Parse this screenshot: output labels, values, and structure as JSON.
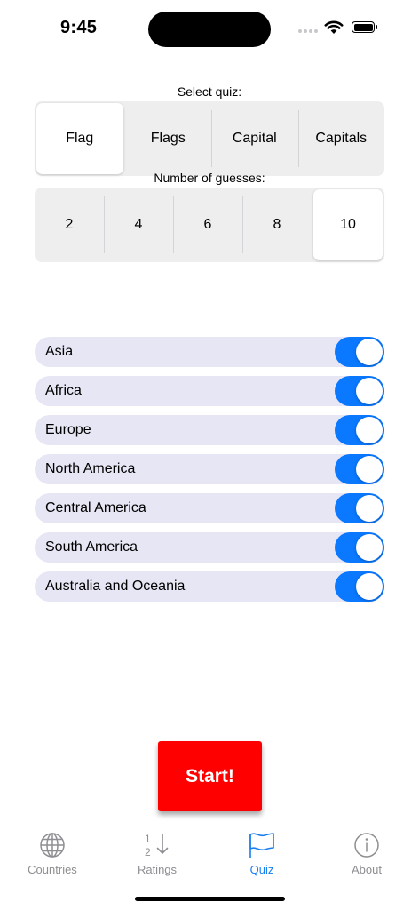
{
  "status_bar": {
    "time": "9:45"
  },
  "quiz_selector": {
    "label": "Select quiz:",
    "options": [
      "Flag",
      "Flags",
      "Capital",
      "Capitals"
    ],
    "selected": "Flag"
  },
  "guesses_selector": {
    "label": "Number of guesses:",
    "options": [
      "2",
      "4",
      "6",
      "8",
      "10"
    ],
    "selected": "10"
  },
  "regions": [
    {
      "label": "Asia",
      "enabled": true
    },
    {
      "label": "Africa",
      "enabled": true
    },
    {
      "label": "Europe",
      "enabled": true
    },
    {
      "label": "North America",
      "enabled": true
    },
    {
      "label": "Central America",
      "enabled": true
    },
    {
      "label": "South America",
      "enabled": true
    },
    {
      "label": "Australia and Oceania",
      "enabled": true
    }
  ],
  "start_button": {
    "label": "Start!"
  },
  "tab_bar": {
    "tabs": [
      {
        "label": "Countries",
        "icon": "globe-icon"
      },
      {
        "label": "Ratings",
        "icon": "sort-ratings-icon",
        "icon_text_top": "1",
        "icon_text_bottom": "2"
      },
      {
        "label": "Quiz",
        "icon": "flag-icon",
        "active": true
      },
      {
        "label": "About",
        "icon": "info-icon"
      }
    ]
  },
  "colors": {
    "accent": "#1a7ff0",
    "toggle_on": "#0a78ff",
    "row_background": "#e7e6f4",
    "start_button": "#ff0000",
    "inactive_tab": "#8e8e93"
  }
}
